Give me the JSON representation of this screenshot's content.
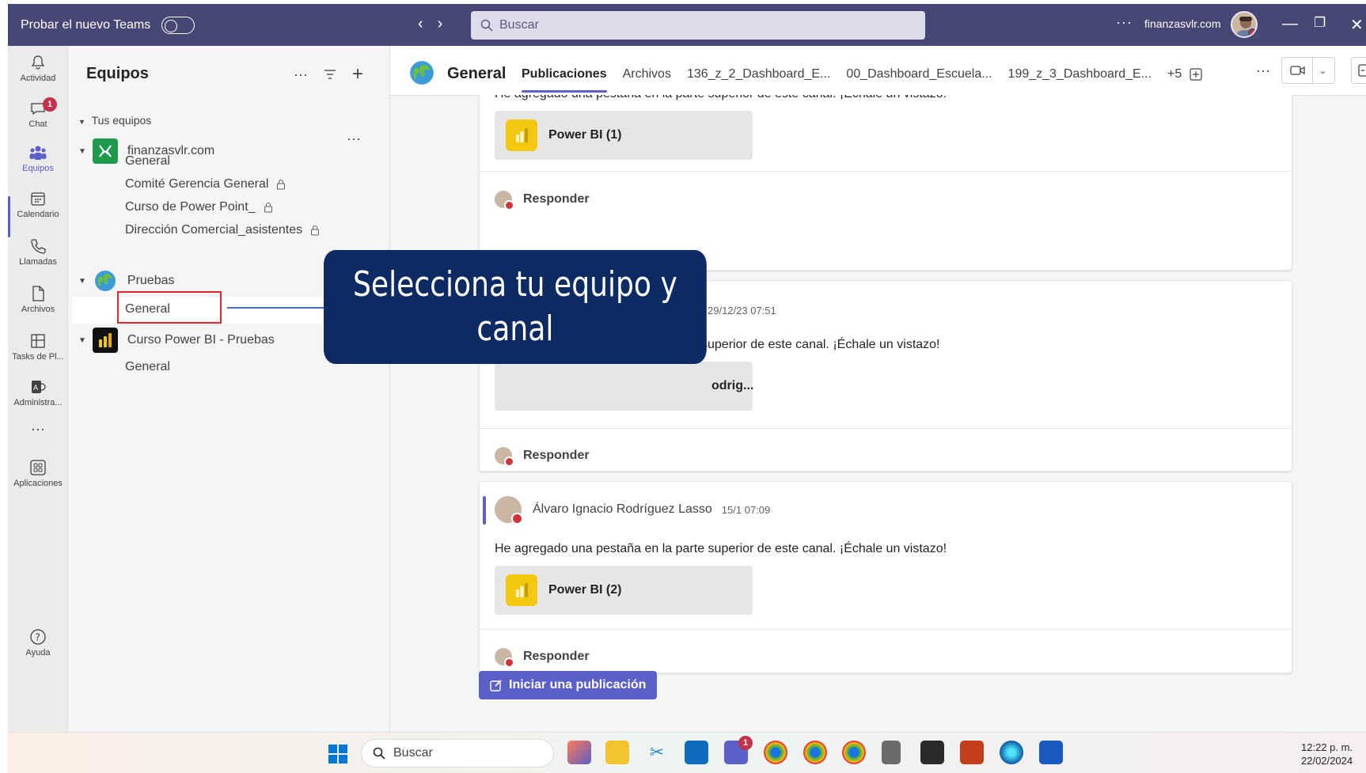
{
  "titlebar": {
    "try_new_teams": "Probar el nuevo Teams",
    "search_placeholder": "Buscar",
    "more": "···",
    "org": "finanzasvlr.com"
  },
  "rail": {
    "items": [
      {
        "label": "Actividad",
        "icon": "bell-icon"
      },
      {
        "label": "Chat",
        "icon": "chat-icon",
        "badge": "1"
      },
      {
        "label": "Equipos",
        "icon": "teams-icon"
      },
      {
        "label": "Calendario",
        "icon": "calendar-icon"
      },
      {
        "label": "Llamadas",
        "icon": "phone-icon"
      },
      {
        "label": "Archivos",
        "icon": "file-icon"
      },
      {
        "label": "Tasks de Pl...",
        "icon": "tasks-icon"
      },
      {
        "label": "Administra...",
        "icon": "admin-icon"
      },
      {
        "label": "Aplicaciones",
        "icon": "apps-icon"
      },
      {
        "label": "Ayuda",
        "icon": "help-icon"
      }
    ],
    "more": "···"
  },
  "teams_panel": {
    "title": "Equipos",
    "section": "Tus equipos",
    "teams": [
      {
        "name": "finanzasvlr.com",
        "channels": [
          "General",
          "Comité Gerencia General",
          "Curso de Power Point_",
          "Dirección Comercial_asistentes"
        ]
      },
      {
        "name": "Pruebas",
        "channels": [
          "General"
        ]
      },
      {
        "name": "Curso Power BI - Pruebas",
        "channels": [
          "General"
        ]
      }
    ],
    "team_more": "···"
  },
  "channel": {
    "name": "General",
    "tabs": [
      "Publicaciones",
      "Archivos",
      "136_z_2_Dashboard_E...",
      "00_Dashboard_Escuela...",
      "199_z_3_Dashboard_E...",
      "+5"
    ],
    "more": "···"
  },
  "posts": [
    {
      "message": "He agregado una pestaña en la parte superior de este canal. ¡Échale un vistazo!",
      "card": "Power BI (1)",
      "reply": "Responder"
    },
    {
      "timestamp": "29/12/23 07:51",
      "message": "superior de este canal. ¡Échale un vistazo!",
      "card": "odrig...",
      "reply": "Responder"
    },
    {
      "author": "Álvaro Ignacio Rodríguez Lasso",
      "timestamp": "15/1 07:09",
      "message": "He agregado una pestaña en la parte superior de este canal. ¡Échale un vistazo!",
      "card": "Power BI (2)",
      "reply": "Responder"
    }
  ],
  "new_post": "Iniciar una publicación",
  "callout": "Selecciona tu equipo y canal",
  "taskbar": {
    "search": "Buscar",
    "time": "12:22 p. m.",
    "date": "22/02/2024",
    "teams_badge": "1"
  },
  "colors": {
    "titlebar": "#464775",
    "accent": "#5b5fc7",
    "callout_bg": "#0d2a63",
    "highlight": "#e0282e"
  }
}
